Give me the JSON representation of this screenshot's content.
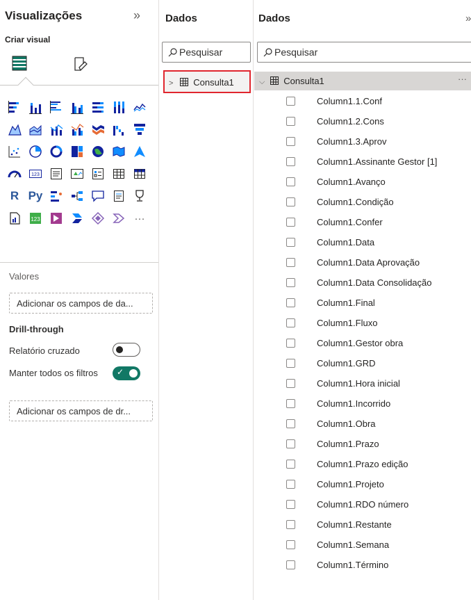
{
  "visualizations": {
    "title": "Visualizações",
    "collapse_icon": "»",
    "criar_visual": "Criar visual",
    "icons": [
      "stacked-bar-chart-icon",
      "stacked-column-chart-icon",
      "clustered-bar-chart-icon",
      "clustered-column-chart-icon",
      "100-stacked-bar-chart-icon",
      "100-stacked-column-chart-icon",
      "line-chart-icon",
      "area-chart-icon",
      "stacked-area-chart-icon",
      "line-and-stacked-column-icon",
      "line-and-clustered-column-icon",
      "ribbon-chart-icon",
      "waterfall-chart-icon",
      "funnel-chart-icon",
      "scatter-chart-icon",
      "pie-chart-icon",
      "donut-chart-icon",
      "treemap-icon",
      "map-icon",
      "filled-map-icon",
      "azure-map-icon",
      "gauge-icon",
      "card-icon",
      "multi-row-card-icon",
      "kpi-icon",
      "slicer-icon",
      "table-icon",
      "matrix-icon",
      "r-script-visual-icon",
      "python-visual-icon",
      "key-influencers-icon",
      "decomposition-tree-icon",
      "qa-icon",
      "smart-narrative-icon",
      "metrics-icon",
      "paginated-report-icon",
      "arcgis-icon",
      "power-apps-icon",
      "power-automate-icon",
      "diamond-visual-icon",
      "chevron-visual-icon",
      "more-icon"
    ],
    "r_label": "R",
    "py_label": "Py",
    "more_label": "···",
    "valores_label": "Valores",
    "valores_placeholder": "Adicionar os campos de da...",
    "drill_through_label": "Drill-through",
    "relatorio_cruzado": "Relatório cruzado",
    "relatorio_cruzado_on": false,
    "manter_filtros": "Manter todos os filtros",
    "manter_filtros_on": true,
    "drill_placeholder": "Adicionar os campos de dr..."
  },
  "data_pane_1": {
    "title": "Dados",
    "search_placeholder": "Pesquisar",
    "table_name": "Consulta1",
    "expanded": false
  },
  "data_pane_2": {
    "title": "Dados",
    "search_placeholder": "Pesquisar",
    "table_name": "Consulta1",
    "expanded": true,
    "more_label": "···",
    "fields": [
      "Column1.1.Conf",
      "Column1.2.Cons",
      "Column1.3.Aprov",
      "Column1.Assinante Gestor [1]",
      "Column1.Avanço",
      "Column1.Condição",
      "Column1.Confer",
      "Column1.Data",
      "Column1.Data Aprovação",
      "Column1.Data Consolidação",
      "Column1.Final",
      "Column1.Fluxo",
      "Column1.Gestor obra",
      "Column1.GRD",
      "Column1.Hora inicial",
      "Column1.Incorrido",
      "Column1.Obra",
      "Column1.Prazo",
      "Column1.Prazo edição",
      "Column1.Projeto",
      "Column1.RDO número",
      "Column1.Restante",
      "Column1.Semana",
      "Column1.Término"
    ]
  },
  "colors": {
    "accent_teal": "#117865",
    "highlight_red": "#e0262e",
    "chart_blue": "#118dff",
    "chart_navy": "#12239e",
    "chart_orange": "#e66c37"
  }
}
